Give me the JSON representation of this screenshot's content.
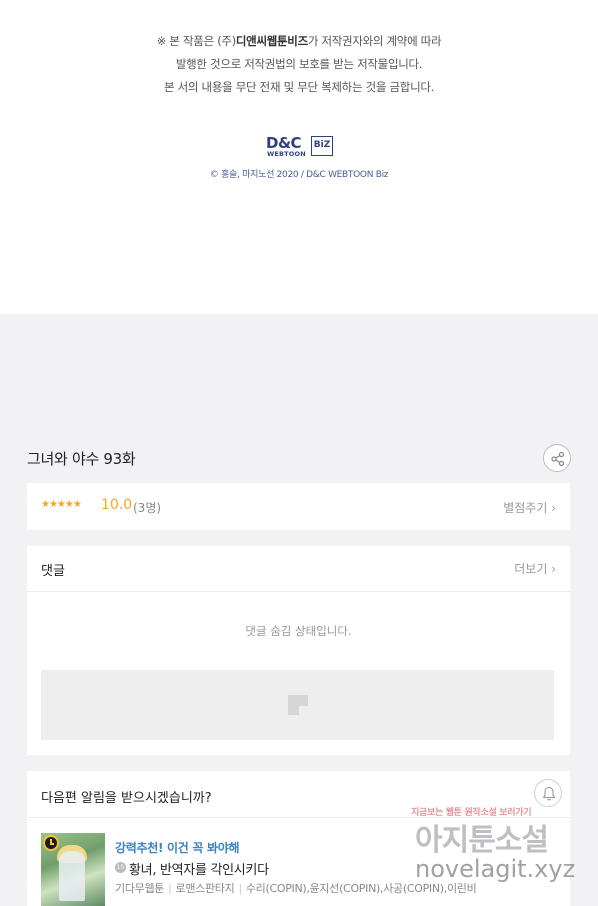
{
  "copyright": {
    "notice_prefix": "※ 본 작품은 (주)",
    "company": "디앤씨웹툰비즈",
    "notice_suffix": "가 저작권자와의 계약에 따라",
    "line2": "발행한 것으로 저작권법의 보호를 받는 저작물입니다.",
    "line3": "본 서의 내용을 무단 전재 및 무단 복제하는 것을 금합니다.",
    "logo": {
      "dc": "D&C",
      "webtoon": "WEBTOON",
      "biz": "BiZ"
    },
    "credit": "© 홍슬, 마지노선 2020 / D&C WEBTOON Biz"
  },
  "episode": {
    "title": "그녀와 야수 93화",
    "share_icon": "share-icon"
  },
  "rating": {
    "stars": "★★★★★",
    "score": "10.0",
    "count": "(3명)",
    "rate_label": "별점주기 ›"
  },
  "comments": {
    "heading": "댓글",
    "more_label": "더보기 ›",
    "hidden_message": "댓글 숨김 상태입니다."
  },
  "notify": {
    "question": "다음편 알림을 받으시겠습니까?",
    "bell_icon": "bell-icon"
  },
  "recommendation": {
    "tag": "강력추천! 이건 꼭 봐야해",
    "age": "15",
    "title": "황녀, 반역자를 각인시키다",
    "publisher": "기다무웹툰",
    "genre": "로맨스판타지",
    "authors": "수리(COPIN),윤지선(COPIN),사공(COPIN),이린비"
  },
  "watermark": {
    "line1": "지금보는 웹툰 원작소설 보러가기",
    "line2": "아지툰소설",
    "line3": "novelagit.xyz"
  }
}
